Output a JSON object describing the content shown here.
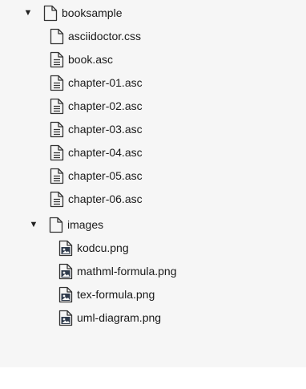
{
  "tree": {
    "root": {
      "label": "booksample",
      "toggle": "▼",
      "icon": "folder-icon"
    },
    "files": [
      {
        "label": "asciidoctor.css",
        "icon": "blank-file-icon"
      },
      {
        "label": "book.asc",
        "icon": "text-file-icon"
      },
      {
        "label": "chapter-01.asc",
        "icon": "text-file-icon"
      },
      {
        "label": "chapter-02.asc",
        "icon": "text-file-icon"
      },
      {
        "label": "chapter-03.asc",
        "icon": "text-file-icon"
      },
      {
        "label": "chapter-04.asc",
        "icon": "text-file-icon"
      },
      {
        "label": "chapter-05.asc",
        "icon": "text-file-icon"
      },
      {
        "label": "chapter-06.asc",
        "icon": "text-file-icon"
      }
    ],
    "images_folder": {
      "label": "images",
      "toggle": "▼",
      "icon": "folder-icon"
    },
    "images": [
      {
        "label": "kodcu.png",
        "icon": "image-file-icon"
      },
      {
        "label": "mathml-formula.png",
        "icon": "image-file-icon"
      },
      {
        "label": "tex-formula.png",
        "icon": "image-file-icon"
      },
      {
        "label": "uml-diagram.png",
        "icon": "image-file-icon"
      }
    ]
  }
}
